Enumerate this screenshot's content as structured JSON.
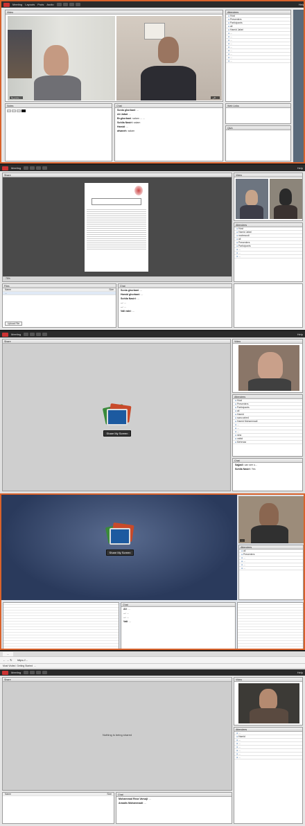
{
  "app": {
    "meeting_menu": "Meeting",
    "layouts_menu": "Layouts",
    "pods_menu": "Pods",
    "audio_menu": "Audio",
    "help": "Help"
  },
  "s1": {
    "video_title": "Video",
    "attendees_title": "Attendees",
    "video_caption_left": "محمدرضا ...",
    "video_caption_right": "علی ...",
    "notes_title": "Notes",
    "chat_title": "Chat",
    "chat_lines": [
      {
        "who": "Sonia ghorbani",
        "text": "..."
      },
      {
        "who": "Ali Jafari",
        "text": "..."
      },
      {
        "who": "Br.ghorbani",
        "text": "salam ... ..."
      },
      {
        "who": "Sohila Nasiri",
        "text": "salam"
      },
      {
        "who": "Hamid",
        "text": "..."
      },
      {
        "who": "afsaneh",
        "text": "salam"
      }
    ],
    "attendees": [
      "Host",
      "Presenters",
      "Participants",
      "ali",
      "Hamid Jafari",
      "...",
      "...",
      "...",
      "...",
      "...",
      "...",
      "...",
      "...",
      "..."
    ],
    "right_lower_title": "Web Links",
    "right_lower_title2": "Q&A"
  },
  "s2": {
    "doc_title": "Share",
    "video_title": "Video",
    "attendees_title": "Attendees",
    "files_title": "Files",
    "chat_title": "Chat",
    "files_header": [
      "Name",
      "Size"
    ],
    "chat_lines": [
      {
        "who": "Sonia ghorbani",
        "text": "..."
      },
      {
        "who": "Hamid ghorbani",
        "text": "..."
      },
      {
        "who": "Sohila Nasiri",
        "text": "..."
      },
      {
        "who": "...",
        "text": "..."
      },
      {
        "who": "...",
        "text": "..."
      },
      {
        "who": "Vali nabi",
        "text": "..."
      }
    ],
    "attendee_list": [
      "Host",
      "Hamid Jafari",
      "mahmoodi",
      "ali",
      "Presenters",
      "Participants",
      "...",
      "...",
      "..."
    ],
    "upload_button": "Upload File",
    "zoom": "75%"
  },
  "s3": {
    "share_title": "Share",
    "share_button": "Share My Screen",
    "video_title": "Video",
    "attendees_title": "Attendees",
    "chat_title": "Chat",
    "attendee_list": [
      "Host",
      "Presenters",
      "Participants",
      "ali",
      "Hamid",
      "sara zahed",
      "Hamid Mohammadi",
      "...",
      "...",
      "...",
      "sina",
      "vahid",
      "Mehrnaz"
    ],
    "chat_lines": [
      {
        "who": "Sajjadi",
        "text": "can see u..."
      },
      {
        "who": "Sohila Nasiri",
        "text": "Yes"
      }
    ]
  },
  "s4": {
    "share_button": "Share My Screen",
    "chat_title": "Chat",
    "attendees_title": "Attendees",
    "video_caption": "...",
    "chat_lines": [
      {
        "who": "Ali",
        "text": "..."
      },
      {
        "who": "...",
        "text": "..."
      },
      {
        "who": "...",
        "text": "..."
      },
      {
        "who": "Vali",
        "text": "..."
      }
    ],
    "attendee_list": [
      "ali",
      "Presenters",
      "...",
      "...",
      "...",
      "..."
    ]
  },
  "s5": {
    "tab_label": "...",
    "url": "https://...",
    "bookmarks": [
      "Most Visited",
      "Getting Started",
      "..."
    ],
    "share_title": "Share",
    "nothing_shared": "Nothing is being shared",
    "video_title": "Video",
    "attendees_title": "Attendees",
    "chat_title": "Chat",
    "files_header": [
      "Name",
      "Size"
    ],
    "chat_lines": [
      {
        "who": "Mohammad Reza Varsaji",
        "text": "..."
      },
      {
        "who": "Amadis Mohammadi",
        "text": "..."
      }
    ],
    "attendee_list": [
      "...",
      "Hamid",
      "...",
      "...",
      "...",
      "...",
      "...",
      "..."
    ]
  }
}
